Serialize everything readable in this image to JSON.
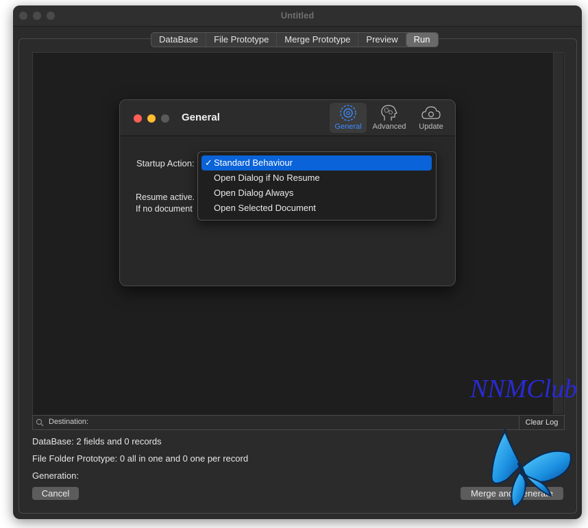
{
  "window": {
    "title": "Untitled"
  },
  "tabs": [
    "DataBase",
    "File Prototype",
    "Merge Prototype",
    "Preview",
    "Run"
  ],
  "active_tab": "Run",
  "log": {
    "destination_label": "Destination:",
    "clear_label": "Clear Log"
  },
  "info": {
    "database": "DataBase:  2 fields and 0 records",
    "prototype": "File Folder Prototype: 0 all in one and 0 one per record",
    "generation": "Generation:"
  },
  "buttons": {
    "cancel": "Cancel",
    "merge": "Merge and Generate"
  },
  "prefs": {
    "title": "General",
    "tabs": [
      {
        "label": "General",
        "icon": "gear-icon"
      },
      {
        "label": "Advanced",
        "icon": "gears-head-icon"
      },
      {
        "label": "Update",
        "icon": "cloud-update-icon"
      }
    ],
    "startup_label": "Startup Action:",
    "desc_line1": "Resume active.",
    "desc_line2": "If no document",
    "menu_items": [
      "Standard Behaviour",
      "Open Dialog if No Resume",
      "Open Dialog Always",
      "Open Selected Document"
    ],
    "menu_check": "✓"
  },
  "watermark": "NNMClub",
  "colors": {
    "accent": "#0a63d8",
    "close": "#ff5f57",
    "minimize": "#febc2e",
    "zoom": "#5a5a5a"
  }
}
